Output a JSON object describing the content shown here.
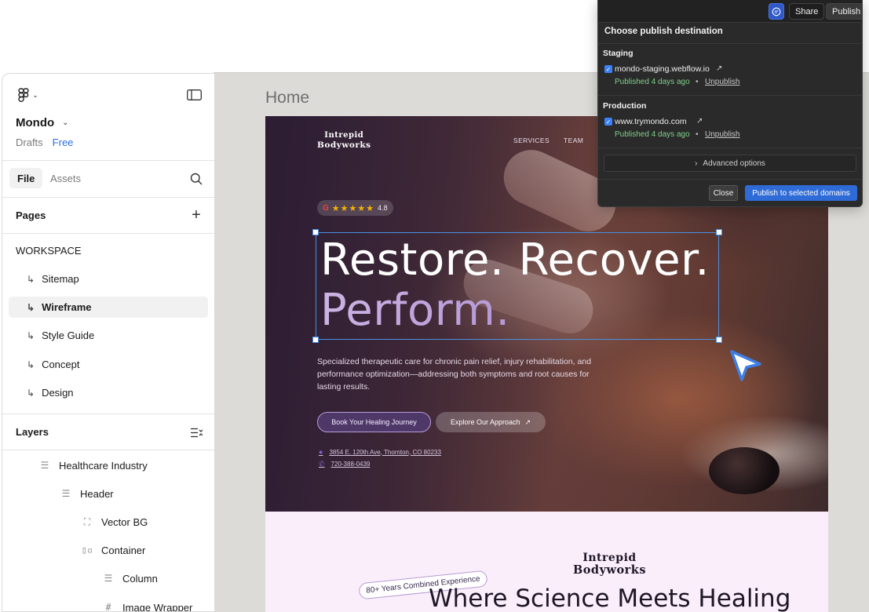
{
  "canvas": {
    "page_label": "Home"
  },
  "site": {
    "logo_line1": "Intrepid",
    "logo_line2": "Bodyworks",
    "nav": [
      "SERVICES",
      "TEAM"
    ],
    "rating": "4.8",
    "stars": "★★★★★",
    "google_letter": "G",
    "headline_line1": "Restore. Recover.",
    "headline_line2": "Perform.",
    "subtext": "Specialized therapeutic care for chronic pain relief, injury rehabilitation, and performance optimization—addressing both symptoms and root causes for lasting results.",
    "btn_primary": "Book Your Healing Journey",
    "btn_secondary": "Explore Our Approach",
    "address": "3854 E. 120th Ave, Thornton, CO 80233",
    "phone": "720-388-0439",
    "section2_badge": "80+ Years Combined Experience",
    "section2_headline": "Where Science Meets Healing"
  },
  "panel": {
    "project_name": "Mondo",
    "drafts": "Drafts",
    "plan": "Free",
    "tabs": {
      "file": "File",
      "assets": "Assets"
    },
    "pages_header": "Pages",
    "workspace": "WORKSPACE",
    "pages": [
      {
        "label": "Sitemap",
        "active": false
      },
      {
        "label": "Wireframe",
        "active": true
      },
      {
        "label": "Style Guide",
        "active": false
      },
      {
        "label": "Concept",
        "active": false
      },
      {
        "label": "Design",
        "active": false
      }
    ],
    "layers_header": "Layers",
    "layers": [
      {
        "label": "Healthcare Industry",
        "icon": "frame-icon"
      },
      {
        "label": "Header",
        "icon": "frame-icon"
      },
      {
        "label": "Vector BG",
        "icon": "vector-icon"
      },
      {
        "label": "Container",
        "icon": "auto-layout-icon"
      },
      {
        "label": "Column",
        "icon": "frame-icon"
      },
      {
        "label": "Image Wrapper",
        "icon": "grid-frame-icon"
      }
    ]
  },
  "publish": {
    "share": "Share",
    "publish": "Publish",
    "title": "Choose publish destination",
    "staging_header": "Staging",
    "staging_domain": "mondo-staging.webflow.io",
    "staging_status": "Published 4 days ago",
    "production_header": "Production",
    "production_domain": "www.trymondo.com",
    "production_status": "Published 4 days ago",
    "unpublish": "Unpublish",
    "advanced": "Advanced options",
    "close": "Close",
    "publish_selected": "Publish to selected domains"
  },
  "colors": {
    "accent_blue": "#2f6bd6",
    "selection": "#4a90e2",
    "published_green": "#7fd08a"
  }
}
